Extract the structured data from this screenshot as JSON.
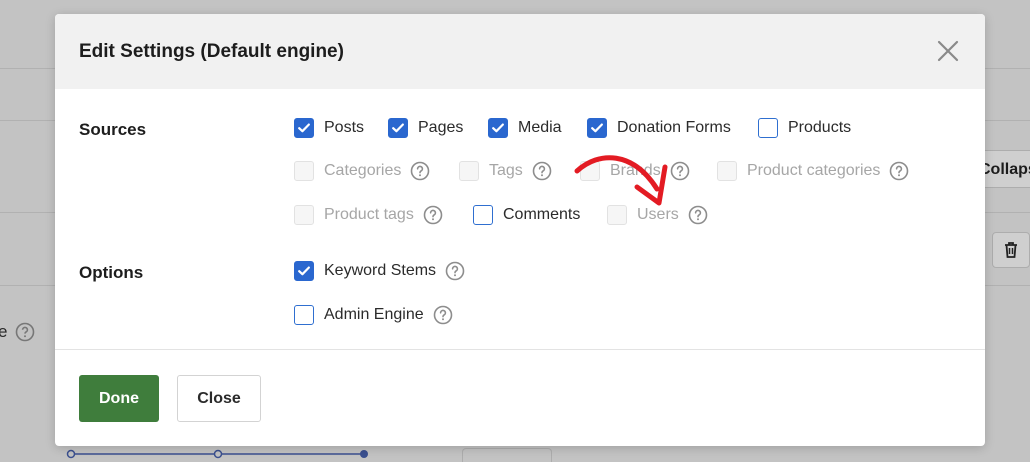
{
  "modal": {
    "title": "Edit Settings (Default engine)",
    "close_icon": "close-icon"
  },
  "sources": {
    "label": "Sources",
    "items": [
      {
        "label": "Posts",
        "checked": true,
        "disabled": false,
        "help": false
      },
      {
        "label": "Pages",
        "checked": true,
        "disabled": false,
        "help": false
      },
      {
        "label": "Media",
        "checked": true,
        "disabled": false,
        "help": false
      },
      {
        "label": "Donation Forms",
        "checked": true,
        "disabled": false,
        "help": false
      },
      {
        "label": "Products",
        "checked": false,
        "disabled": false,
        "help": false
      },
      {
        "label": "Categories",
        "checked": false,
        "disabled": true,
        "help": true
      },
      {
        "label": "Tags",
        "checked": false,
        "disabled": true,
        "help": true
      },
      {
        "label": "Brands",
        "checked": false,
        "disabled": true,
        "help": true
      },
      {
        "label": "Product categories",
        "checked": false,
        "disabled": true,
        "help": true
      },
      {
        "label": "Product tags",
        "checked": false,
        "disabled": true,
        "help": true
      },
      {
        "label": "Comments",
        "checked": false,
        "disabled": false,
        "help": false
      },
      {
        "label": "Users",
        "checked": false,
        "disabled": true,
        "help": true
      }
    ]
  },
  "options": {
    "label": "Options",
    "items": [
      {
        "label": "Keyword Stems",
        "checked": true,
        "disabled": false,
        "help": true
      },
      {
        "label": "Admin Engine",
        "checked": false,
        "disabled": false,
        "help": true
      }
    ]
  },
  "footer": {
    "done_label": "Done",
    "close_label": "Close"
  },
  "background": {
    "collapse_label": "Collapse All"
  },
  "colors": {
    "accent_blue": "#2a67cf",
    "done_green": "#3f7d3c",
    "annotation_red": "#e31b23"
  }
}
